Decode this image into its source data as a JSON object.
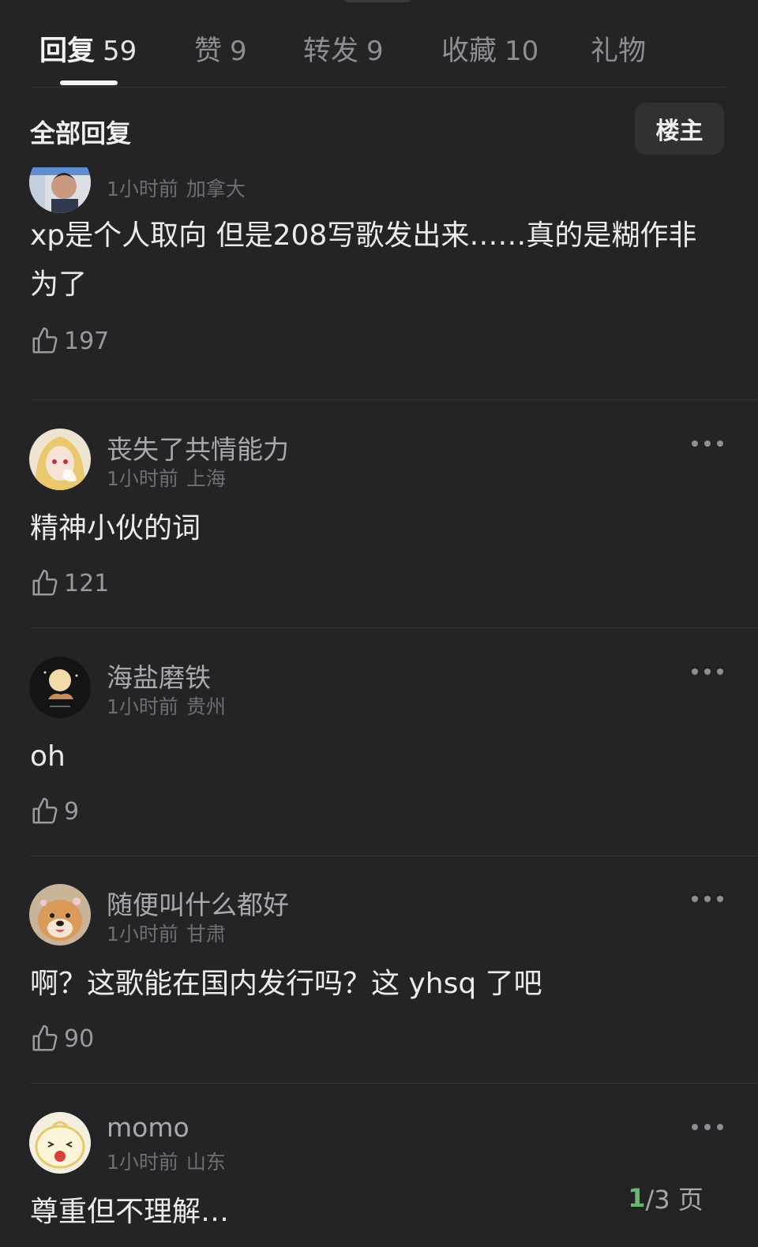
{
  "tabs": [
    {
      "label": "回复",
      "count": "59"
    },
    {
      "label": "赞",
      "count": "9"
    },
    {
      "label": "转发",
      "count": "9"
    },
    {
      "label": "收藏",
      "count": "10"
    },
    {
      "label": "礼物",
      "count": ""
    }
  ],
  "filter": {
    "title": "全部回复",
    "op_button": "楼主"
  },
  "comments": [
    {
      "username": "",
      "time": "1小时前",
      "location": "加拿大",
      "text": "xp是个人取向 但是208写歌发出来……真的是糊作非为了",
      "likes": "197"
    },
    {
      "username": "丧失了共情能力",
      "time": "1小时前",
      "location": "上海",
      "text": "精神小伙的词",
      "likes": "121"
    },
    {
      "username": "海盐磨铁",
      "time": "1小时前",
      "location": "贵州",
      "text": "oh",
      "likes": "9"
    },
    {
      "username": "随便叫什么都好",
      "time": "1小时前",
      "location": "甘肃",
      "text": "啊？这歌能在国内发行吗？这 yhsq 了吧",
      "likes": "90"
    },
    {
      "username": "momo",
      "time": "1小时前",
      "location": "山东",
      "text": "尊重但不理解…",
      "likes": ""
    }
  ],
  "pager": {
    "current": "1",
    "rest": "/3 页"
  },
  "icons": {
    "like": "thumbs-up-icon",
    "more": "more-dots-icon"
  }
}
